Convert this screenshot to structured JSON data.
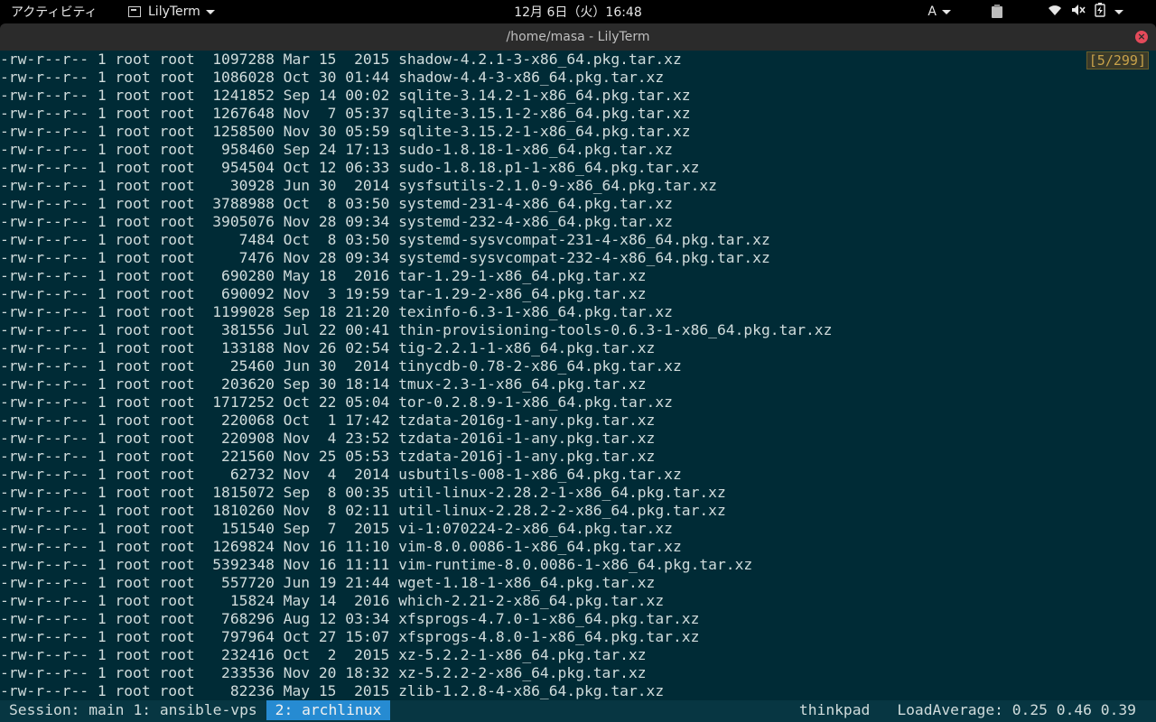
{
  "topbar": {
    "activities": "アクティビティ",
    "app_name": "LilyTerm",
    "clock": "12月  6日（火）16:48",
    "ime": "A",
    "icons": [
      "wifi-icon",
      "volume-muted-icon",
      "battery-charging-icon",
      "power-menu-icon"
    ]
  },
  "window": {
    "title": "/home/masa - LilyTerm",
    "close_glyph": "×"
  },
  "terminal": {
    "position_counter": "[5/299]",
    "lines": [
      "-rw-r--r-- 1 root root  1097288 Mar 15  2015 shadow-4.2.1-3-x86_64.pkg.tar.xz",
      "-rw-r--r-- 1 root root  1086028 Oct 30 01:44 shadow-4.4-3-x86_64.pkg.tar.xz",
      "-rw-r--r-- 1 root root  1241852 Sep 14 00:02 sqlite-3.14.2-1-x86_64.pkg.tar.xz",
      "-rw-r--r-- 1 root root  1267648 Nov  7 05:37 sqlite-3.15.1-2-x86_64.pkg.tar.xz",
      "-rw-r--r-- 1 root root  1258500 Nov 30 05:59 sqlite-3.15.2-1-x86_64.pkg.tar.xz",
      "-rw-r--r-- 1 root root   958460 Sep 24 17:13 sudo-1.8.18-1-x86_64.pkg.tar.xz",
      "-rw-r--r-- 1 root root   954504 Oct 12 06:33 sudo-1.8.18.p1-1-x86_64.pkg.tar.xz",
      "-rw-r--r-- 1 root root    30928 Jun 30  2014 sysfsutils-2.1.0-9-x86_64.pkg.tar.xz",
      "-rw-r--r-- 1 root root  3788988 Oct  8 03:50 systemd-231-4-x86_64.pkg.tar.xz",
      "-rw-r--r-- 1 root root  3905076 Nov 28 09:34 systemd-232-4-x86_64.pkg.tar.xz",
      "-rw-r--r-- 1 root root     7484 Oct  8 03:50 systemd-sysvcompat-231-4-x86_64.pkg.tar.xz",
      "-rw-r--r-- 1 root root     7476 Nov 28 09:34 systemd-sysvcompat-232-4-x86_64.pkg.tar.xz",
      "-rw-r--r-- 1 root root   690280 May 18  2016 tar-1.29-1-x86_64.pkg.tar.xz",
      "-rw-r--r-- 1 root root   690092 Nov  3 19:59 tar-1.29-2-x86_64.pkg.tar.xz",
      "-rw-r--r-- 1 root root  1199028 Sep 18 21:20 texinfo-6.3-1-x86_64.pkg.tar.xz",
      "-rw-r--r-- 1 root root   381556 Jul 22 00:41 thin-provisioning-tools-0.6.3-1-x86_64.pkg.tar.xz",
      "-rw-r--r-- 1 root root   133188 Nov 26 02:54 tig-2.2.1-1-x86_64.pkg.tar.xz",
      "-rw-r--r-- 1 root root    25460 Jun 30  2014 tinycdb-0.78-2-x86_64.pkg.tar.xz",
      "-rw-r--r-- 1 root root   203620 Sep 30 18:14 tmux-2.3-1-x86_64.pkg.tar.xz",
      "-rw-r--r-- 1 root root  1717252 Oct 22 05:04 tor-0.2.8.9-1-x86_64.pkg.tar.xz",
      "-rw-r--r-- 1 root root   220068 Oct  1 17:42 tzdata-2016g-1-any.pkg.tar.xz",
      "-rw-r--r-- 1 root root   220908 Nov  4 23:52 tzdata-2016i-1-any.pkg.tar.xz",
      "-rw-r--r-- 1 root root   221560 Nov 25 05:53 tzdata-2016j-1-any.pkg.tar.xz",
      "-rw-r--r-- 1 root root    62732 Nov  4  2014 usbutils-008-1-x86_64.pkg.tar.xz",
      "-rw-r--r-- 1 root root  1815072 Sep  8 00:35 util-linux-2.28.2-1-x86_64.pkg.tar.xz",
      "-rw-r--r-- 1 root root  1810260 Nov  8 02:11 util-linux-2.28.2-2-x86_64.pkg.tar.xz",
      "-rw-r--r-- 1 root root   151540 Sep  7  2015 vi-1:070224-2-x86_64.pkg.tar.xz",
      "-rw-r--r-- 1 root root  1269824 Nov 16 11:10 vim-8.0.0086-1-x86_64.pkg.tar.xz",
      "-rw-r--r-- 1 root root  5392348 Nov 16 11:11 vim-runtime-8.0.0086-1-x86_64.pkg.tar.xz",
      "-rw-r--r-- 1 root root   557720 Jun 19 21:44 wget-1.18-1-x86_64.pkg.tar.xz",
      "-rw-r--r-- 1 root root    15824 May 14  2016 which-2.21-2-x86_64.pkg.tar.xz",
      "-rw-r--r-- 1 root root   768296 Aug 12 03:34 xfsprogs-4.7.0-1-x86_64.pkg.tar.xz",
      "-rw-r--r-- 1 root root   797964 Oct 27 15:07 xfsprogs-4.8.0-1-x86_64.pkg.tar.xz",
      "-rw-r--r-- 1 root root   232416 Oct  2  2015 xz-5.2.2-1-x86_64.pkg.tar.xz",
      "-rw-r--r-- 1 root root   233536 Nov 20 18:32 xz-5.2.2-2-x86_64.pkg.tar.xz",
      "-rw-r--r-- 1 root root    82236 May 15  2015 zlib-1.2.8-4-x86_64.pkg.tar.xz"
    ]
  },
  "statusbar": {
    "session": "Session: main",
    "windows": [
      {
        "label": "1: ansible-vps",
        "active": false
      },
      {
        "label": "2: archlinux",
        "active": true
      }
    ],
    "host": "thinkpad",
    "load": "LoadAverage: 0.25 0.46 0.39"
  },
  "colors": {
    "terminal_bg": "#002b36",
    "statusbar_bg": "#073642",
    "active_window_bg": "#268bd2",
    "close_button": "#e44a5a"
  }
}
